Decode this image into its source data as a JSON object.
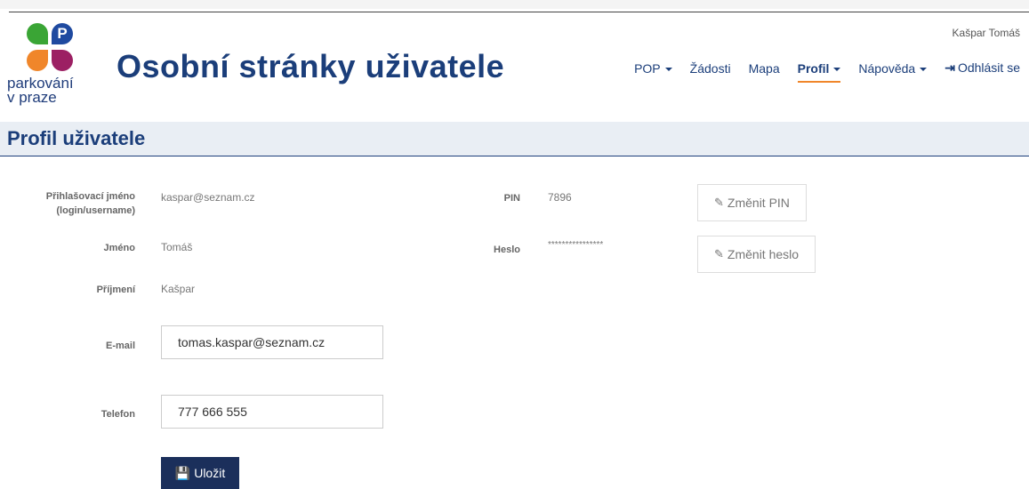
{
  "header": {
    "title": "Osobní stránky uživatele",
    "user": "Kašpar Tomáš",
    "logo": {
      "line1": "parkování",
      "line2": "v praze",
      "badge": "P"
    }
  },
  "nav": [
    {
      "label": "POP",
      "dropdown": true
    },
    {
      "label": "Žádosti",
      "dropdown": false
    },
    {
      "label": "Mapa",
      "dropdown": false
    },
    {
      "label": "Profil",
      "dropdown": true,
      "active": true
    },
    {
      "label": "Nápověda",
      "dropdown": true
    },
    {
      "label": "Odhlásit se",
      "dropdown": false,
      "icon": "logout-icon"
    }
  ],
  "section": {
    "title": "Profil uživatele"
  },
  "profile": {
    "login_label": "Přihlašovací jméno (login/username)",
    "login_value": "kaspar@seznam.cz",
    "name_label": "Jméno",
    "name_value": "Tomáš",
    "surname_label": "Příjmení",
    "surname_value": "Kašpar",
    "email_label": "E-mail",
    "email_value": "tomas.kaspar@seznam.cz",
    "phone_label": "Telefon",
    "phone_value": "777 666 555",
    "pin_label": "PIN",
    "pin_value": "7896",
    "password_label": "Heslo",
    "password_value": "****************",
    "change_pin": "Změnit PIN",
    "change_password": "Změnit heslo",
    "save": "Uložit"
  },
  "colors": {
    "brand": "#1b3e7a",
    "accent": "#f0862a",
    "save_button": "#1b2f5b"
  }
}
